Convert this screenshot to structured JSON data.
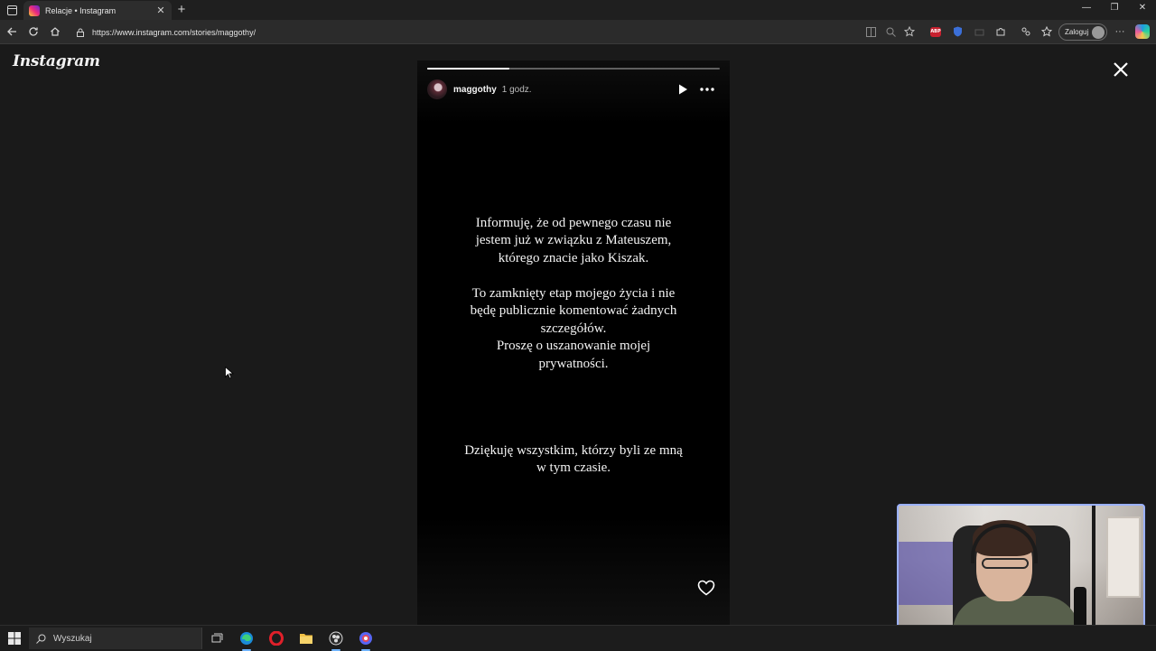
{
  "browser": {
    "tab_title": "Relacje • Instagram",
    "url": "https://www.instagram.com/stories/maggothy/",
    "login_label": "Zaloguj",
    "abp_label": "ABP"
  },
  "instagram": {
    "logo": "Instagram",
    "story": {
      "username": "maggothy",
      "time": "1 godz.",
      "progress": 0.28,
      "paragraph1": [
        "Informuję, że od pewnego czasu nie",
        "jestem już w związku z Mateuszem,",
        "którego znacie jako Kiszak."
      ],
      "paragraph2": [
        "To zamknięty etap mojego życia i nie",
        "będę publicznie komentować żadnych",
        "szczegółów.",
        "Proszę o uszanowanie mojej",
        "prywatności."
      ],
      "paragraph3": [
        "Dziękuję wszystkim, którzy byli ze mną",
        "w tym czasie."
      ]
    }
  },
  "taskbar": {
    "search_label": "Wyszukaj"
  },
  "icons": {
    "tab_favicon": "instagram-icon",
    "close": "close-icon",
    "play": "play-icon",
    "more": "more-icon",
    "like": "heart-icon"
  },
  "colors": {
    "background": "#1a1a1a",
    "story_background": "#000000",
    "text": "#f3f3f3",
    "abp": "#c8202f"
  }
}
